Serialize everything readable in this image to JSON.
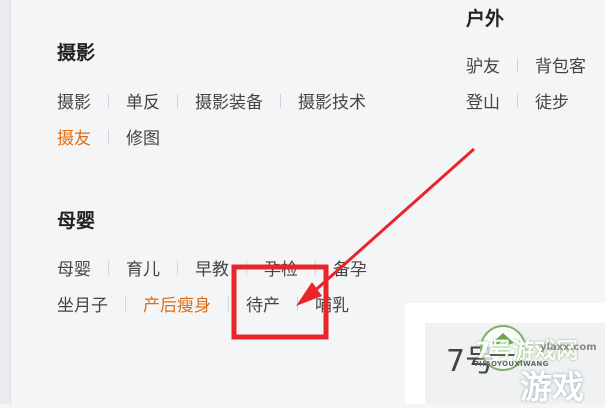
{
  "photography": {
    "title": "摄影",
    "row1": [
      "摄影",
      "单反",
      "摄影装备",
      "摄影技术"
    ],
    "row2": [
      {
        "label": "摄友",
        "highlight": true
      },
      {
        "label": "修图",
        "highlight": false
      }
    ]
  },
  "maternity": {
    "title": "母婴",
    "row1": [
      "母婴",
      "育儿",
      "早教",
      "孕检",
      "备孕"
    ],
    "row2": [
      {
        "label": "坐月子",
        "highlight": false
      },
      {
        "label": "产后瘦身",
        "highlight": true
      },
      {
        "label": "待产",
        "highlight": false
      },
      {
        "label": "哺乳",
        "highlight": false
      }
    ]
  },
  "outdoor": {
    "title": "户外",
    "row1": [
      "驴友",
      "背包客"
    ],
    "row2": [
      "登山",
      "徒步"
    ]
  },
  "tile": {
    "number": "7号"
  },
  "watermark": {
    "top_text": "7号游戏网",
    "sub_text": "7HAOYOUXIWANG",
    "big_text": "游戏",
    "url_text": "ylaxx.com"
  },
  "colors": {
    "highlight": "#e06e14",
    "annotation_red": "#e8262a",
    "background": "#f4f5f7"
  }
}
